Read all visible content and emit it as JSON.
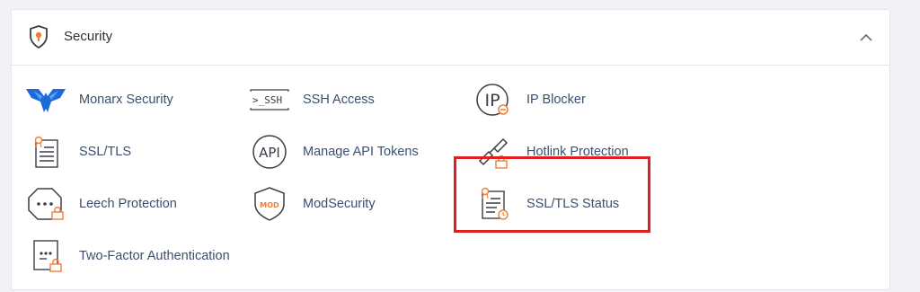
{
  "panel": {
    "title": "Security",
    "header_icon": "security-shield-icon",
    "collapse_icon": "chevron-up-icon"
  },
  "items": [
    {
      "label": "Monarx Security",
      "icon": "monarx-butterfly-icon"
    },
    {
      "label": "SSH Access",
      "icon": "ssh-terminal-icon",
      "icon_text": ">_SSH"
    },
    {
      "label": "IP Blocker",
      "icon": "ip-blocker-icon",
      "icon_text": "IP"
    },
    {
      "label": "SSL/TLS",
      "icon": "certificate-icon"
    },
    {
      "label": "Manage API Tokens",
      "icon": "api-icon",
      "icon_text": "API"
    },
    {
      "label": "Hotlink Protection",
      "icon": "hotlink-chain-lock-icon"
    },
    {
      "label": "Leech Protection",
      "icon": "leech-octagon-lock-icon"
    },
    {
      "label": "ModSecurity",
      "icon": "modsecurity-shield-icon",
      "icon_text": "MOD"
    },
    {
      "label": "SSL/TLS Status",
      "icon": "certificate-status-icon"
    },
    {
      "label": "Two-Factor Authentication",
      "icon": "two-factor-lock-icon"
    }
  ],
  "colors": {
    "accent_orange": "#f07f32",
    "icon_dark": "#3a3f46",
    "link_blue": "#3a4f71",
    "monarx_blue": "#1c6bd6",
    "highlight_red": "#e02020"
  }
}
